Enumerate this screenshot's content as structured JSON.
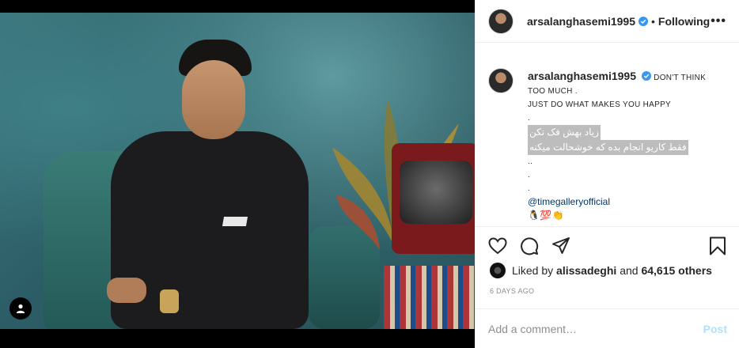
{
  "post": {
    "username": "arsalanghasemi1995",
    "dot": "•",
    "follow_state": "Following",
    "more_icon": "more-horizontal-icon",
    "verified_color": "#3897f0",
    "caption_lines": [
      "DON'T THINK",
      "TOO MUCH .",
      "JUST DO WHAT MAKES YOU HAPPY",
      "."
    ],
    "caption_rtl": [
      "زیاد بهش فک نکن",
      "فقط کاریو انجام بده که خوشحالت میکنه"
    ],
    "caption_dots": [
      "..",
      ".",
      "."
    ],
    "mention": "@timegalleryofficial",
    "emojis": "🐧💯👏",
    "likes_prefix": "Liked by",
    "likes_user": "alissadeghi",
    "likes_and": "and",
    "likes_others": "64,615 others",
    "timestamp": "6 DAYS AGO",
    "comment_placeholder": "Add a comment…",
    "post_label": "Post"
  }
}
